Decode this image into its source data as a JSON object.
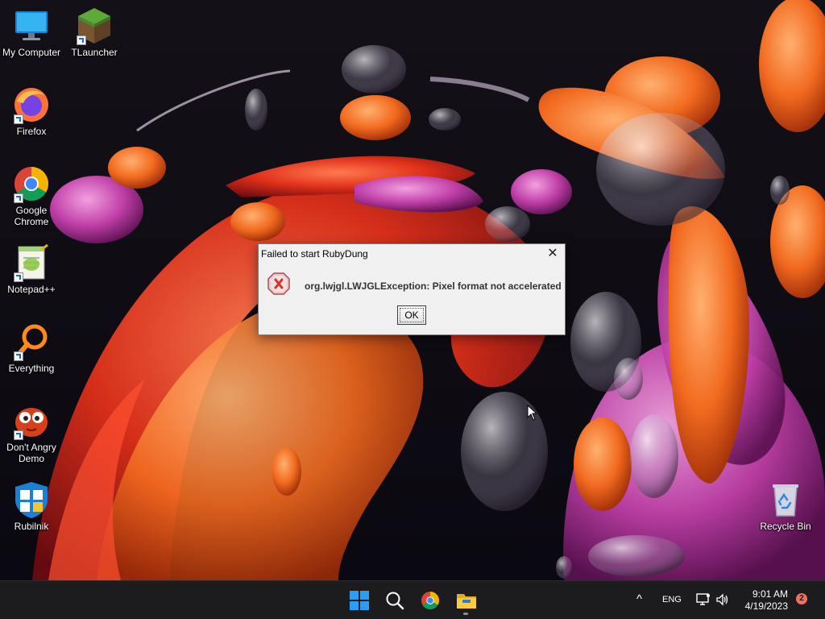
{
  "desktop": {
    "icons": [
      {
        "label": "My Computer",
        "icon": "monitor-icon"
      },
      {
        "label": "TLauncher",
        "icon": "grass-block-icon"
      },
      {
        "label": "Firefox",
        "icon": "firefox-icon"
      },
      {
        "label": "Google Chrome",
        "icon": "chrome-icon"
      },
      {
        "label": "Notepad++",
        "icon": "notepadpp-icon"
      },
      {
        "label": "Everything",
        "icon": "magnifier-orange-icon"
      },
      {
        "label": "Don't Angry Demo",
        "icon": "red-face-icon"
      },
      {
        "label": "Rubilnik",
        "icon": "shield-icon"
      },
      {
        "label": "Recycle Bin",
        "icon": "recycle-bin-icon"
      }
    ]
  },
  "dialog": {
    "title": "Failed to start RubyDung",
    "message": "org.lwjgl.LWJGLException: Pixel format not accelerated",
    "ok_label": "OK",
    "close_glyph": "✕",
    "icon": "error-icon"
  },
  "taskbar": {
    "pinned": [
      {
        "name": "start-button",
        "icon": "windows-logo-icon"
      },
      {
        "name": "search-button",
        "icon": "search-icon"
      },
      {
        "name": "chrome-taskbar-button",
        "icon": "chrome-icon"
      },
      {
        "name": "file-explorer-button",
        "icon": "folder-icon",
        "active": true
      }
    ],
    "tray": {
      "chevron": "^",
      "language": "ENG",
      "time": "9:01 AM",
      "date": "4/19/2023",
      "notifications": "2"
    }
  },
  "colors": {
    "taskbar_bg": "#1c1c1e",
    "dialog_bg": "#f0f0f0",
    "error_red": "#d9302b",
    "accent_blue": "#0078d4"
  }
}
